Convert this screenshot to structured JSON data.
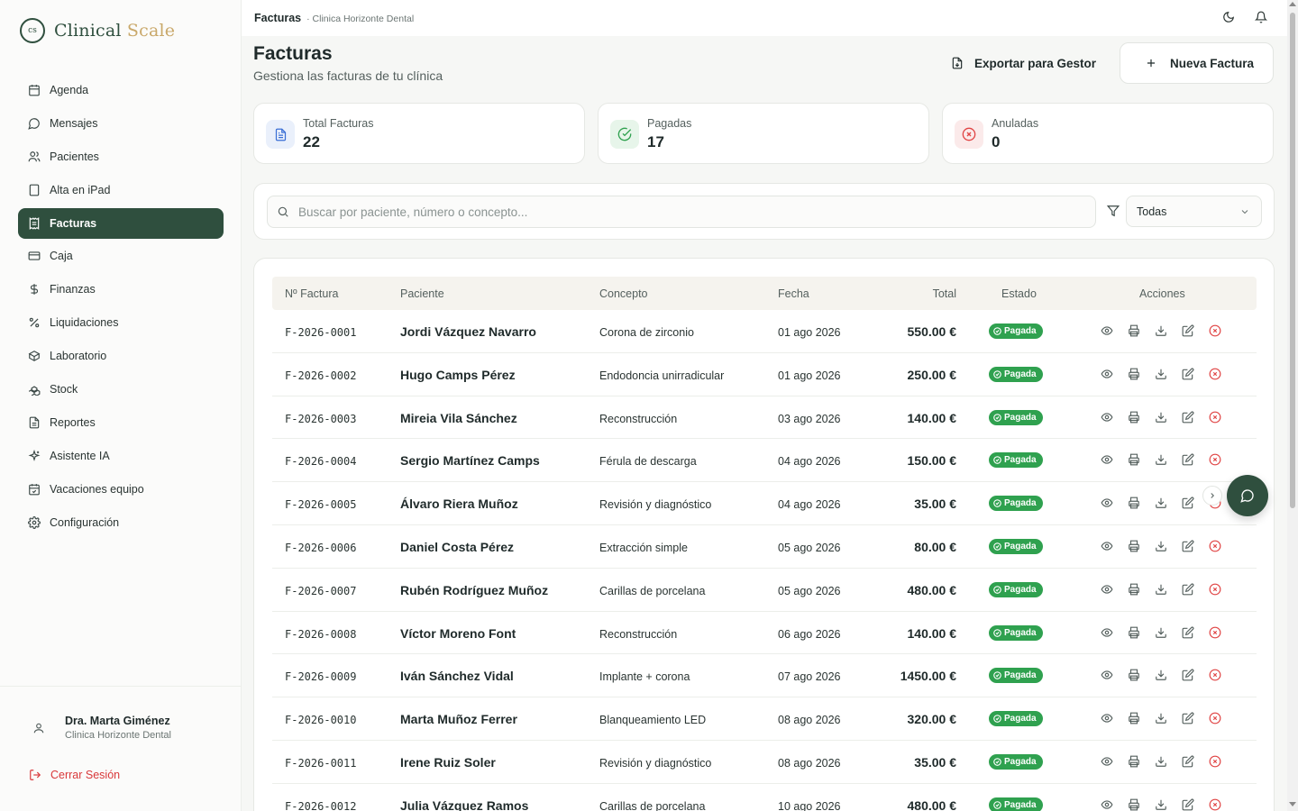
{
  "brand": {
    "mark": "cs",
    "name_main": "Clinical ",
    "name_accent": "Scale"
  },
  "sidebar": {
    "items": [
      {
        "label": "Agenda",
        "icon": "calendar-icon",
        "active": false
      },
      {
        "label": "Mensajes",
        "icon": "message-icon",
        "active": false
      },
      {
        "label": "Pacientes",
        "icon": "users-icon",
        "active": false
      },
      {
        "label": "Alta en iPad",
        "icon": "tablet-icon",
        "active": false
      },
      {
        "label": "Facturas",
        "icon": "receipt-icon",
        "active": true
      },
      {
        "label": "Caja",
        "icon": "wallet-icon",
        "active": false
      },
      {
        "label": "Finanzas",
        "icon": "dollar-icon",
        "active": false
      },
      {
        "label": "Liquidaciones",
        "icon": "percent-icon",
        "active": false
      },
      {
        "label": "Laboratorio",
        "icon": "box-icon",
        "active": false
      },
      {
        "label": "Stock",
        "icon": "boxes-icon",
        "active": false
      },
      {
        "label": "Reportes",
        "icon": "report-icon",
        "active": false
      },
      {
        "label": "Asistente IA",
        "icon": "sparkles-icon",
        "active": false
      },
      {
        "label": "Vacaciones equipo",
        "icon": "calendar-check-icon",
        "active": false
      },
      {
        "label": "Configuración",
        "icon": "gear-icon",
        "active": false
      }
    ],
    "user": {
      "name": "Dra. Marta Giménez",
      "clinic": "Clinica Horizonte Dental"
    },
    "logout_label": "Cerrar Sesión"
  },
  "topbar": {
    "crumb_main": "Facturas",
    "crumb_sub": "· Clinica Horizonte Dental"
  },
  "header": {
    "title": "Facturas",
    "subtitle": "Gestiona las facturas de tu clínica",
    "export_label": "Exportar para Gestor",
    "new_label": "Nueva Factura"
  },
  "stats": [
    {
      "label": "Total Facturas",
      "value": "22",
      "color": "#3b6fd6",
      "bg": "#eaf0fb"
    },
    {
      "label": "Pagadas",
      "value": "17",
      "color": "#2fa14f",
      "bg": "#e7f5ea"
    },
    {
      "label": "Anuladas",
      "value": "0",
      "color": "#e04444",
      "bg": "#fbeaea"
    }
  ],
  "search": {
    "placeholder": "Buscar por paciente, número o concepto...",
    "filter_value": "Todas"
  },
  "table": {
    "headers": {
      "num": "Nº Factura",
      "patient": "Paciente",
      "concept": "Concepto",
      "date": "Fecha",
      "total": "Total",
      "status": "Estado",
      "actions": "Acciones"
    },
    "rows": [
      {
        "num": "F-2026-0001",
        "patient": "Jordi Vázquez Navarro",
        "concept": "Corona de zirconio",
        "date": "01 ago 2026",
        "total": "550.00 €",
        "status": "Pagada"
      },
      {
        "num": "F-2026-0002",
        "patient": "Hugo Camps Pérez",
        "concept": "Endodoncia unirradicular",
        "date": "01 ago 2026",
        "total": "250.00 €",
        "status": "Pagada"
      },
      {
        "num": "F-2026-0003",
        "patient": "Mireia Vila Sánchez",
        "concept": "Reconstrucción",
        "date": "03 ago 2026",
        "total": "140.00 €",
        "status": "Pagada"
      },
      {
        "num": "F-2026-0004",
        "patient": "Sergio Martínez Camps",
        "concept": "Férula de descarga",
        "date": "04 ago 2026",
        "total": "150.00 €",
        "status": "Pagada"
      },
      {
        "num": "F-2026-0005",
        "patient": "Álvaro Riera Muñoz",
        "concept": "Revisión y diagnóstico",
        "date": "04 ago 2026",
        "total": "35.00 €",
        "status": "Pagada"
      },
      {
        "num": "F-2026-0006",
        "patient": "Daniel Costa Pérez",
        "concept": "Extracción simple",
        "date": "05 ago 2026",
        "total": "80.00 €",
        "status": "Pagada"
      },
      {
        "num": "F-2026-0007",
        "patient": "Rubén Rodríguez Muñoz",
        "concept": "Carillas de porcelana",
        "date": "05 ago 2026",
        "total": "480.00 €",
        "status": "Pagada"
      },
      {
        "num": "F-2026-0008",
        "patient": "Víctor Moreno Font",
        "concept": "Reconstrucción",
        "date": "06 ago 2026",
        "total": "140.00 €",
        "status": "Pagada"
      },
      {
        "num": "F-2026-0009",
        "patient": "Iván Sánchez Vidal",
        "concept": "Implante + corona",
        "date": "07 ago 2026",
        "total": "1450.00 €",
        "status": "Pagada"
      },
      {
        "num": "F-2026-0010",
        "patient": "Marta Muñoz Ferrer",
        "concept": "Blanqueamiento LED",
        "date": "08 ago 2026",
        "total": "320.00 €",
        "status": "Pagada"
      },
      {
        "num": "F-2026-0011",
        "patient": "Irene Ruiz Soler",
        "concept": "Revisión y diagnóstico",
        "date": "08 ago 2026",
        "total": "35.00 €",
        "status": "Pagada"
      },
      {
        "num": "F-2026-0012",
        "patient": "Julia Vázquez Ramos",
        "concept": "Carillas de porcelana",
        "date": "10 ago 2026",
        "total": "480.00 €",
        "status": "Pagada"
      }
    ]
  },
  "colors": {
    "brand": "#2f4f3e",
    "accent": "#c9a86a",
    "paid": "#2fa14f",
    "danger": "#e04444"
  }
}
